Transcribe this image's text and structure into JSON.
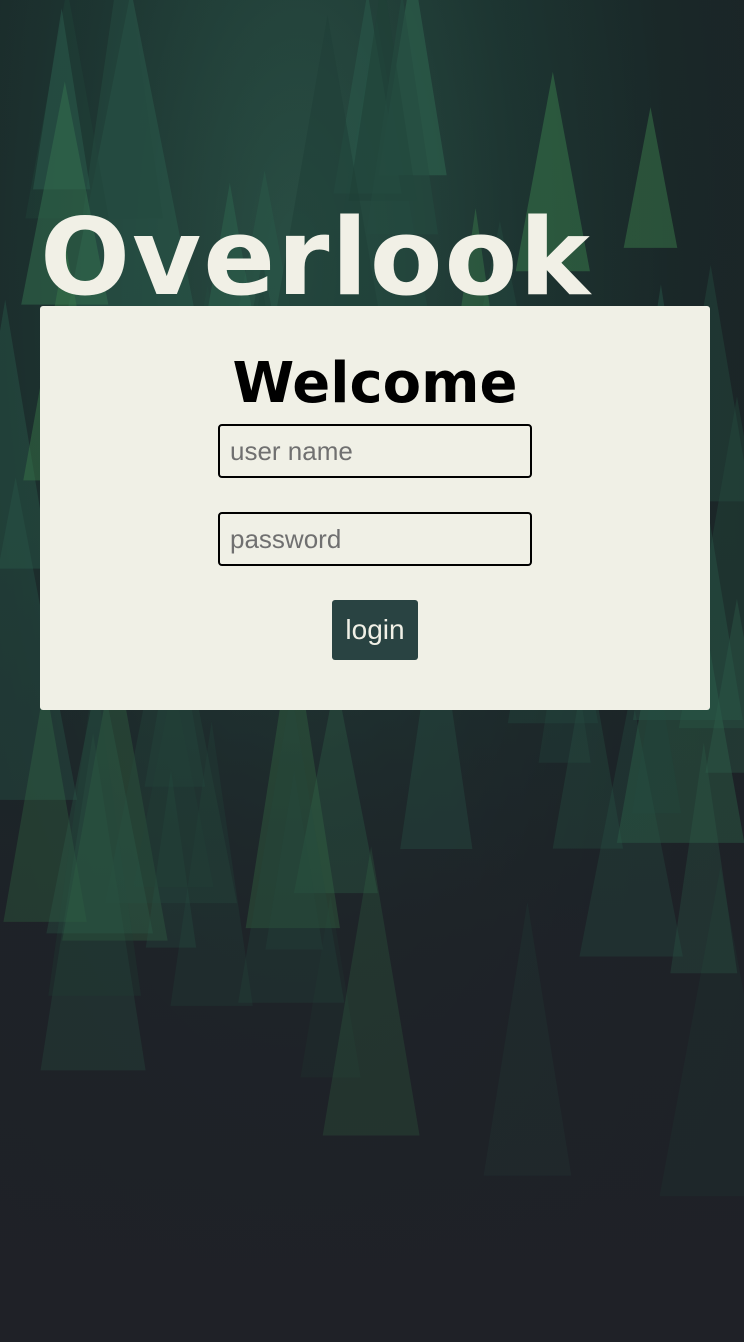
{
  "app": {
    "title": "Overlook"
  },
  "login": {
    "heading": "Welcome",
    "username_placeholder": "user name",
    "password_placeholder": "password",
    "button_label": "login"
  },
  "colors": {
    "title": "#f1f0e6",
    "card_background": "#f0f0e6",
    "button_background": "#294342",
    "page_background": "#1f2127"
  },
  "background": {
    "description_icon": "pine-forest-image"
  }
}
